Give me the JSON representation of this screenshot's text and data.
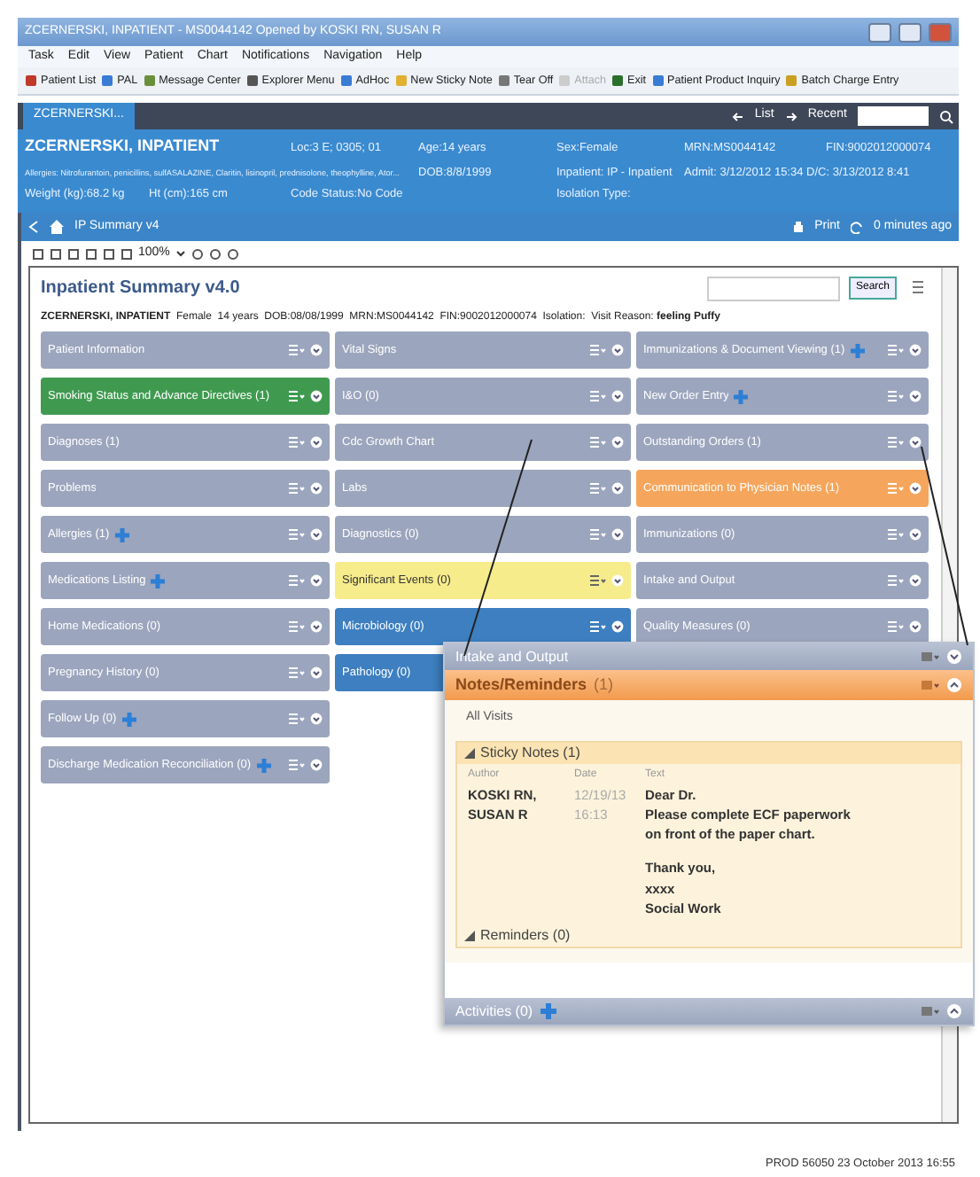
{
  "window": {
    "title": "ZCERNERSKI, INPATIENT - MS0044142 Opened by KOSKI RN, SUSAN R"
  },
  "menu": [
    "Task",
    "Edit",
    "View",
    "Patient",
    "Chart",
    "Notifications",
    "Navigation",
    "Help"
  ],
  "toolbar": [
    {
      "label": "Patient List",
      "disabled": false
    },
    {
      "label": "PAL",
      "disabled": false
    },
    {
      "label": "Message Center",
      "disabled": false
    },
    {
      "label": "Explorer Menu",
      "disabled": false
    },
    {
      "label": "AdHoc",
      "disabled": false
    },
    {
      "label": "New Sticky Note",
      "disabled": false
    },
    {
      "label": "Tear Off",
      "disabled": false
    },
    {
      "label": "Attach",
      "disabled": true
    },
    {
      "label": "Exit",
      "disabled": false
    },
    {
      "label": "Patient Product Inquiry",
      "disabled": false
    },
    {
      "label": "Batch Charge Entry",
      "disabled": false
    }
  ],
  "tab_bar": {
    "tab": "ZCERNERSKI...",
    "list": "List",
    "recent": "Recent"
  },
  "banner": {
    "row_1": [
      "ZCERNERSKI, INPATIENT",
      "Loc:3 E; 0305; 01",
      "Age:14 years",
      "Sex:Female",
      "MRN:MS0044142",
      "FIN:9002012000074"
    ],
    "row_2": [
      "Allergies: Nitrofurantoin, penicillins, sulfASALAZINE, Claritin, lisinopril, prednisolone, theophylline, Ator...",
      "DOB:8/8/1999",
      "Inpatient: IP - Inpatient",
      "Admit: 3/12/2012 15:34  D/C: 3/13/2012 8:41"
    ],
    "row_3": [
      "Weight (kg):68.2 kg",
      "Ht (cm):165 cm",
      "Code Status:No Code",
      "Isolation Type:"
    ]
  },
  "nav": {
    "page": "IP Summary v4",
    "print": "Print",
    "updated": "0 minutes ago"
  },
  "zoom": "100%",
  "summary": {
    "title": "Inpatient Summary v4.0",
    "search_button": "Search",
    "patient_line": "**ZCERNERSKI, INPATIENT**  Female  14 years  DOB:08/08/1999  MRN:MS0044142  FIN:9002012000074  Isolation:  Visit Reason: **feeling Puffy**",
    "columns": [
      [
        {
          "label": "Patient Information",
          "color": "#9ba5bd",
          "plus": false
        },
        {
          "label": "Smoking Status and Advance Directives (1)",
          "color": "#3f9a50",
          "plus": false
        },
        {
          "label": "Diagnoses (1)",
          "color": "#9ba5bd",
          "plus": false
        },
        {
          "label": "Problems",
          "color": "#9ba5bd",
          "plus": false
        },
        {
          "label": "Allergies (1)",
          "color": "#9ba5bd",
          "plus": true
        },
        {
          "label": "Medications Listing",
          "color": "#9ba5bd",
          "plus": true
        },
        {
          "label": "Home Medications (0)",
          "color": "#9ba5bd",
          "plus": false
        },
        {
          "label": "Pregnancy History (0)",
          "color": "#9ba5bd",
          "plus": false
        },
        {
          "label": "Follow Up (0)",
          "color": "#9ba5bd",
          "plus": true
        },
        {
          "label": "Discharge Medication Reconciliation (0)",
          "color": "#9ba5bd",
          "plus": true
        }
      ],
      [
        {
          "label": "Vital Signs",
          "color": "#9ba5bd",
          "plus": false
        },
        {
          "label": "I&O (0)",
          "color": "#9ba5bd",
          "plus": false
        },
        {
          "label": "Cdc Growth Chart",
          "color": "#9ba5bd",
          "plus": false
        },
        {
          "label": "Labs",
          "color": "#9ba5bd",
          "plus": false
        },
        {
          "label": "Diagnostics (0)",
          "color": "#9ba5bd",
          "plus": false
        },
        {
          "label": "Significant Events (0)",
          "color": "#f7ec8c",
          "plus": false
        },
        {
          "label": "Microbiology (0)",
          "color": "#3d7fc0",
          "plus": false
        },
        {
          "label": "Pathology (0)",
          "color": "#3d7fc0",
          "plus": false
        }
      ],
      [
        {
          "label": "Immunizations & Document Viewing (1)",
          "color": "#9ba5bd",
          "plus": true
        },
        {
          "label": "New Order Entry",
          "color": "#9ba5bd",
          "plus": true
        },
        {
          "label": "Outstanding Orders (1)",
          "color": "#9ba5bd",
          "plus": false
        },
        {
          "label": "Communication to Physician Notes (1)",
          "color": "#f6a65c",
          "plus": false
        },
        {
          "label": "Immunizations (0)",
          "color": "#9ba5bd",
          "plus": false
        },
        {
          "label": "Intake and Output",
          "color": "#9ba5bd",
          "plus": false
        },
        {
          "label": "Quality Measures (0)",
          "color": "#9ba5bd",
          "plus": false
        }
      ]
    ]
  },
  "popup": {
    "intake": {
      "label": "Intake and Output",
      "expanded": false
    },
    "notes": {
      "label": "Notes/Reminders",
      "count": "(1)",
      "expanded": true
    },
    "filter": "All Visits",
    "sticky": {
      "label": "Sticky Notes (1)",
      "expanded": true
    },
    "columns": [
      "Author",
      "Date",
      "Text"
    ],
    "note": {
      "author": "KOSKI RN, SUSAN R",
      "date": "12/19/13 16:13",
      "paragraphs": [
        [
          "Dear Dr.",
          "Please complete ECF paperwork",
          "on front of the paper chart."
        ],
        [
          "Thank you,",
          "xxxx",
          "Social Work"
        ]
      ]
    },
    "reminders": {
      "label": "Reminders (0)",
      "expanded": true
    },
    "activities": {
      "label": "Activities (0)",
      "expanded": true
    }
  },
  "footer": "PROD 56050 23 October 2013 16:55"
}
